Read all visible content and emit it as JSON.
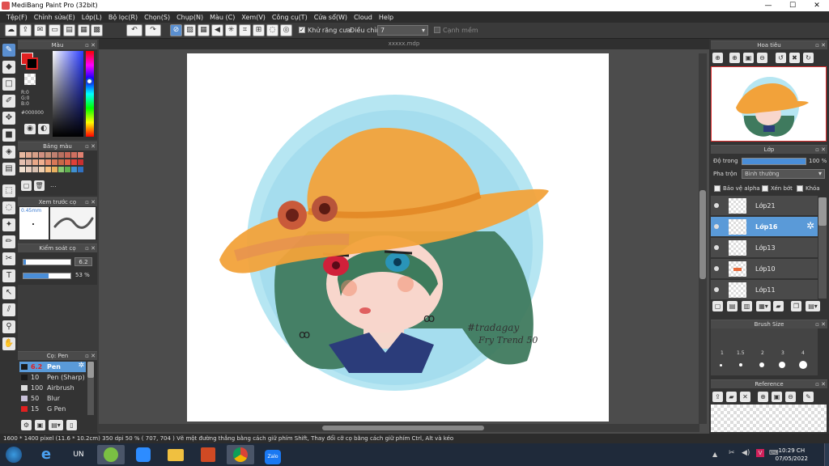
{
  "window": {
    "title": "MediBang Paint Pro (32bit)",
    "minimize": "—",
    "maximize": "☐",
    "close": "✕"
  },
  "menu": [
    "Tệp(F)",
    "Chỉnh sửa(E)",
    "Lớp(L)",
    "Bộ lọc(R)",
    "Chọn(S)",
    "Chụp(N)",
    "Màu (C)",
    "Xem(V)",
    "Công cụ(T)",
    "Cửa sổ(W)",
    "Cloud",
    "Help"
  ],
  "toolbar": {
    "antialias_label": "Khử răng cưa",
    "stabilizer_label": "Điều chỉnh",
    "stabilizer_value": "7",
    "snap_label": "Cạnh mềm"
  },
  "color_panel": {
    "title": "Màu",
    "rgb": [
      "R:0",
      "G:0",
      "B:0"
    ],
    "hex": "#000000",
    "fg_color": "#000000",
    "accent_color": "#e02020"
  },
  "palette_panel": {
    "title": "Bảng màu",
    "colors": [
      "#e6b8a0",
      "#e0a890",
      "#d8a088",
      "#d09080",
      "#c89078",
      "#c08070",
      "#b87060",
      "#c86858",
      "#d07060",
      "#e08070",
      "#e4c0b0",
      "#d8b0a0",
      "#e8a888",
      "#f0b090",
      "#e89070",
      "#d87858",
      "#c86848",
      "#e06048",
      "#e04038",
      "#c83030",
      "#f0e0d0",
      "#e8d0c0",
      "#d8c0b0",
      "#f0d0b0",
      "#f8c080",
      "#e8b060",
      "#88c870",
      "#60b050",
      "#4090d0",
      "#3070c0"
    ],
    "more_label": "..."
  },
  "brush_preview": {
    "title": "Xem trước cọ",
    "size_label": "0.45mm"
  },
  "brush_control": {
    "title": "Kiểm soát cọ",
    "size_value": "6.2",
    "opacity_value": "53 %"
  },
  "brush_list": {
    "title": "Cọ: Pen",
    "items": [
      {
        "size": "6.2",
        "name": "Pen"
      },
      {
        "size": "10",
        "name": "Pen (Sharp)"
      },
      {
        "size": "100",
        "name": "Airbrush"
      },
      {
        "size": "50",
        "name": "Blur"
      },
      {
        "size": "15",
        "name": "G Pen"
      }
    ]
  },
  "document": {
    "tab_title": "xxxxx.mdp"
  },
  "artwork": {
    "signature_line1": "#tradagay",
    "signature_line2": "Fry Trend 50"
  },
  "navigator": {
    "title": "Hoa tiêu"
  },
  "layers_panel": {
    "title": "Lớp",
    "opacity_label": "Độ trong",
    "opacity_value": "100 %",
    "blend_label": "Pha trộn",
    "blend_value": "Bình thường",
    "protect_alpha": "Bảo vệ alpha",
    "clipping": "Xén bớt",
    "lock": "Khóa",
    "layers": [
      {
        "name": "Lớp21"
      },
      {
        "name": "Lớp16"
      },
      {
        "name": "Lớp13"
      },
      {
        "name": "Lớp10"
      },
      {
        "name": "Lớp11"
      }
    ]
  },
  "brush_size_panel": {
    "title": "Brush Size",
    "sizes": [
      "1",
      "1.5",
      "2",
      "3",
      "4"
    ]
  },
  "reference_panel": {
    "title": "Reference"
  },
  "status": {
    "dimensions": "1600 * 1400 pixel",
    "physical": "(11.6 * 10.2cm)",
    "dpi": "350 dpi",
    "zoom": "50 %",
    "coords": "( 707, 704 )",
    "hint": "Vẽ một đường thẳng bằng cách giữ phím Shift, Thay đổi cỡ cọ bằng cách giữ phím Ctrl, Alt và kéo"
  },
  "taskbar": {
    "time": "10:29 CH",
    "date": "07/05/2022",
    "zalo_label": "Zalo"
  }
}
